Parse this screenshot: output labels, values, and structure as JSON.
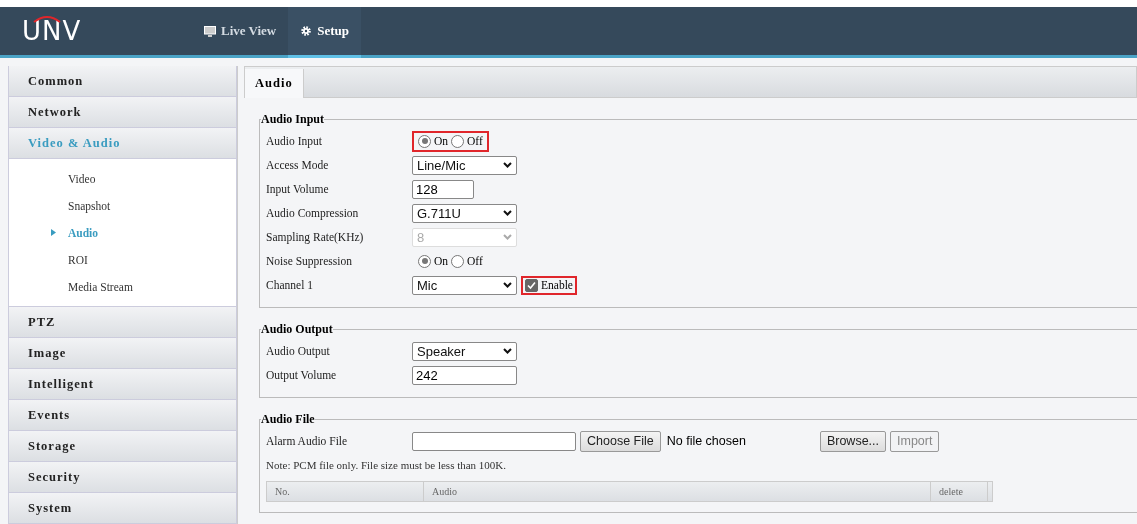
{
  "header": {
    "logo": "UNV",
    "nav": [
      {
        "label": "Live View",
        "selected": false
      },
      {
        "label": "Setup",
        "selected": true
      }
    ]
  },
  "sidebar": [
    {
      "label": "Common",
      "selected": false
    },
    {
      "label": "Network",
      "selected": false
    },
    {
      "label": "Video & Audio",
      "selected": true,
      "expanded": true,
      "children": [
        {
          "label": "Video",
          "selected": false
        },
        {
          "label": "Snapshot",
          "selected": false
        },
        {
          "label": "Audio",
          "selected": true
        },
        {
          "label": "ROI",
          "selected": false
        },
        {
          "label": "Media Stream",
          "selected": false
        }
      ]
    },
    {
      "label": "PTZ",
      "selected": false
    },
    {
      "label": "Image",
      "selected": false
    },
    {
      "label": "Intelligent",
      "selected": false
    },
    {
      "label": "Events",
      "selected": false
    },
    {
      "label": "Storage",
      "selected": false
    },
    {
      "label": "Security",
      "selected": false
    },
    {
      "label": "System",
      "selected": false
    }
  ],
  "tabs": [
    {
      "label": "Audio",
      "selected": true
    }
  ],
  "sections": [
    {
      "title": "Audio Input",
      "rows": [
        {
          "kind": "radio",
          "label": "Audio Input",
          "highlighted": true,
          "options": [
            {
              "label": "On",
              "selected": true
            },
            {
              "label": "Off",
              "selected": false
            }
          ]
        },
        {
          "kind": "select",
          "label": "Access Mode",
          "value": "Line/Mic",
          "disabled": false
        },
        {
          "kind": "number",
          "label": "Input Volume",
          "value": "128"
        },
        {
          "kind": "select",
          "label": "Audio Compression",
          "value": "G.711U",
          "disabled": false
        },
        {
          "kind": "select",
          "label": "Sampling Rate(KHz)",
          "value": "8",
          "disabled": true
        },
        {
          "kind": "radio",
          "label": "Noise Suppression",
          "highlighted": false,
          "options": [
            {
              "label": "On",
              "selected": true
            },
            {
              "label": "Off",
              "selected": false
            }
          ]
        },
        {
          "kind": "selectcheck",
          "label": "Channel 1",
          "value": "Mic",
          "check_label": "Enable",
          "checked": true,
          "highlighted": true
        }
      ]
    },
    {
      "title": "Audio Output",
      "rows": [
        {
          "kind": "select",
          "label": "Audio Output",
          "value": "Speaker",
          "disabled": false
        },
        {
          "kind": "text",
          "label": "Output Volume",
          "value": "242"
        }
      ]
    },
    {
      "title": "Audio File",
      "rows": [
        {
          "kind": "file",
          "label": "Alarm Audio File",
          "choose": "Choose File",
          "status": "No file chosen",
          "buttons": [
            {
              "label": "Browse...",
              "disabled": false
            },
            {
              "label": "Import",
              "disabled": true
            }
          ]
        },
        {
          "kind": "note",
          "text": "Note: PCM file only. File size must be less than 100K."
        }
      ],
      "table": {
        "columns": [
          "No.",
          "Audio",
          "delete"
        ]
      }
    }
  ]
}
